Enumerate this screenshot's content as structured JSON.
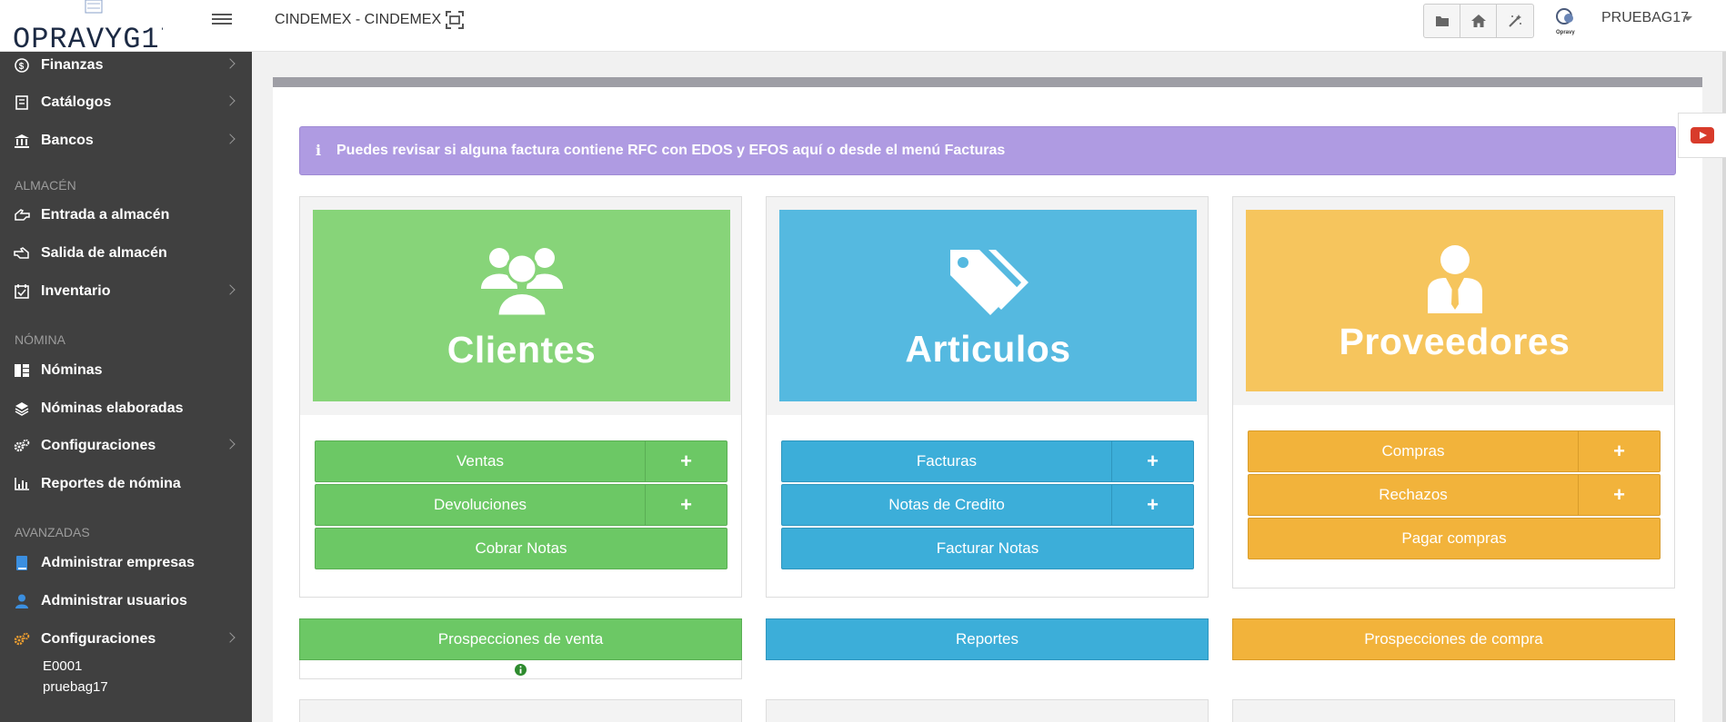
{
  "header": {
    "company": "CINDEMEX - CINDEMEX",
    "user_name": "PRUEBAG17",
    "avatar_caption": "Opravy"
  },
  "sidebar": {
    "items_top": [
      {
        "label": "Finanzas",
        "icon": "dollar-icon",
        "chevron": true
      },
      {
        "label": "Catálogos",
        "icon": "book-icon",
        "chevron": true
      },
      {
        "label": "Bancos",
        "icon": "bank-icon",
        "chevron": true
      }
    ],
    "section_almacen": "ALMACÉN",
    "items_almacen": [
      {
        "label": "Entrada a almacén",
        "icon": "hand-left-icon",
        "chevron": false
      },
      {
        "label": "Salida de almacén",
        "icon": "hand-right-icon",
        "chevron": false
      },
      {
        "label": "Inventario",
        "icon": "calendar-check-icon",
        "chevron": true
      }
    ],
    "section_nomina": "NÓMINA",
    "items_nomina": [
      {
        "label": "Nóminas",
        "icon": "list-icon",
        "chevron": false
      },
      {
        "label": "Nóminas elaboradas",
        "icon": "layers-icon",
        "chevron": false
      },
      {
        "label": "Configuraciones",
        "icon": "gears-icon",
        "chevron": true
      },
      {
        "label": "Reportes de nómina",
        "icon": "bar-chart-icon",
        "chevron": false
      }
    ],
    "section_avanzadas": "AVANZADAS",
    "items_avanzadas": [
      {
        "label": "Administrar empresas",
        "icon": "book-blue-icon",
        "chevron": false
      },
      {
        "label": "Administrar usuarios",
        "icon": "user-blue-icon",
        "chevron": false
      },
      {
        "label": "Configuraciones",
        "icon": "gears-orange-icon",
        "chevron": true
      }
    ],
    "footer_code": "E0001",
    "footer_user": "pruebag17"
  },
  "alert": {
    "text": "Puedes revisar si alguna factura contiene RFC con EDOS y EFOS aquí o desde el menú Facturas"
  },
  "cards": {
    "clientes": {
      "title": "Clientes",
      "buttons": [
        "Ventas",
        "Devoluciones",
        "Cobrar Notas"
      ],
      "plus": "+"
    },
    "articulos": {
      "title": "Articulos",
      "buttons": [
        "Facturas",
        "Notas de Credito",
        "Facturar Notas"
      ],
      "plus": "+"
    },
    "proveedores": {
      "title": "Proveedores",
      "buttons": [
        "Compras",
        "Rechazos",
        "Pagar compras"
      ],
      "plus": "+"
    }
  },
  "bottom": {
    "prospecciones_venta": "Prospecciones de venta",
    "reportes": "Reportes",
    "prospecciones_compra": "Prospecciones de compra"
  },
  "colors": {
    "green": "#6cc865",
    "blue": "#3caed9",
    "yellow": "#f2b33b",
    "sidebar": "#404040",
    "alert": "#af9be2"
  }
}
